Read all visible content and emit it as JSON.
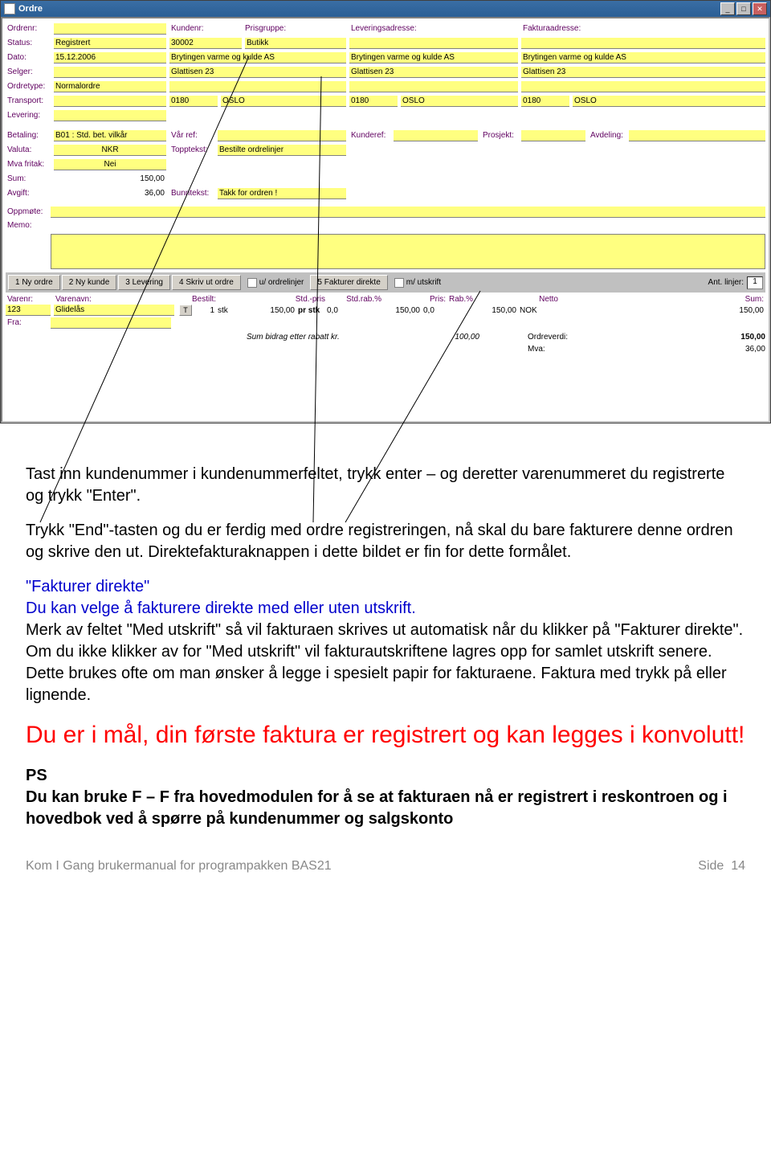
{
  "window": {
    "title": "Ordre"
  },
  "header": {
    "col1": {
      "ordrenr_lbl": "Ordrenr:",
      "status_lbl": "Status:",
      "status": "Registrert",
      "dato_lbl": "Dato:",
      "dato": "15.12.2006",
      "selger_lbl": "Selger:",
      "ordretype_lbl": "Ordretype:",
      "ordretype": "Normalordre",
      "transport_lbl": "Transport:",
      "levering_lbl": "Levering:"
    },
    "col2": {
      "kundenr_lbl": "Kundenr:",
      "kundenr": "30002",
      "prisgruppe_lbl": "Prisgruppe:",
      "prisgruppe": "Butikk",
      "navn": "Brytingen varme og kulde AS",
      "adresse": "Glattisen 23",
      "postnr": "0180",
      "sted": "OSLO"
    },
    "col3": {
      "lev_lbl": "Leveringsadresse:",
      "navn": "Brytingen varme og kulde AS",
      "adresse": "Glattisen 23",
      "postnr": "0180",
      "sted": "OSLO"
    },
    "col4": {
      "fak_lbl": "Fakturaadresse:",
      "navn": "Brytingen varme og kulde AS",
      "adresse": "Glattisen 23",
      "postnr": "0180",
      "sted": "OSLO"
    }
  },
  "mid": {
    "betaling_lbl": "Betaling:",
    "betaling": "B01 : Std. bet. vilkår",
    "valuta_lbl": "Valuta:",
    "valuta": "NKR",
    "mva_lbl": "Mva fritak:",
    "mva": "Nei",
    "sum_lbl": "Sum:",
    "sum": "150,00",
    "avgift_lbl": "Avgift:",
    "avgift": "36,00",
    "varref_lbl": "Vår ref:",
    "topptekst_lbl": "Topptekst:",
    "topptekst": "Bestilte ordrelinjer",
    "bunntekst_lbl": "Bunntekst:",
    "bunntekst": "Takk for ordren !",
    "kunderef_lbl": "Kunderef:",
    "prosjekt_lbl": "Prosjekt:",
    "avdeling_lbl": "Avdeling:"
  },
  "oppmote": {
    "lbl": "Oppmøte:",
    "memo_lbl": "Memo:"
  },
  "toolbar": {
    "b1": "1 Ny ordre",
    "b2": "2 Ny kunde",
    "b3": "3 Levering",
    "b4": "4 Skriv ut ordre",
    "chk1": "u/ ordrelinjer",
    "b5": "5 Fakturer direkte",
    "chk2": "m/ utskrift",
    "ant_lbl": "Ant. linjer:",
    "ant": "1"
  },
  "lines": {
    "hdr": {
      "varenr": "Varenr:",
      "varenavn": "Varenavn:",
      "bestilt": "Bestilt:",
      "stdpris": "Std.-pris",
      "stdrab": "Std.rab.%",
      "pris": "Pris:",
      "rab": "Rab.%",
      "netto": "Netto",
      "sum": "Sum:"
    },
    "row": {
      "varenr": "123",
      "varenavn": "Glidelås",
      "t": "T",
      "bestilt": "1",
      "enhet": "stk",
      "stdpris": "150,00",
      "prstk": "pr stk",
      "stdrab": "0,0",
      "pris": "150,00",
      "rab": "0,0",
      "netto": "150,00",
      "cur": "NOK",
      "sum": "150,00"
    },
    "fra_lbl": "Fra:",
    "sumbidrag_lbl": "Sum bidrag etter rabatt kr.",
    "sumbidrag": "100,00",
    "ordreverdi_lbl": "Ordreverdi:",
    "ordreverdi": "150,00",
    "mva_lbl": "Mva:",
    "mva": "36,00"
  },
  "doc": {
    "p1": "Tast inn kundenummer i kundenummerfeltet, trykk enter – og deretter varenummeret du registrerte og trykk \"Enter\".",
    "p2": "Trykk \"End\"-tasten og du er ferdig med ordre registreringen, nå skal du bare fakturere denne ordren og skrive den ut. Direktefakturaknappen i dette bildet er fin for dette formålet.",
    "p3a": "\"Fakturer direkte\"",
    "p3b": "Du kan velge å fakturere direkte med eller uten utskrift.",
    "p3c": "Merk av feltet \"Med utskrift\" så vil fakturaen skrives ut automatisk når du klikker på \"Fakturer direkte\". Om du ikke klikker av for \"Med utskrift\" vil fakturautskriftene lagres opp for samlet utskrift senere. Dette brukes ofte om man ønsker å legge i spesielt papir for fakturaene. Faktura med trykk på eller lignende.",
    "p4": "Du er i mål, din første faktura er registrert og kan legges i konvolutt!",
    "p5a": "PS",
    "p5b": "Du kan bruke F – F fra hovedmodulen for å se at fakturaen nå er registrert i reskontroen og i hovedbok ved å spørre på kundenummer og salgskonto"
  },
  "footer": {
    "left": "Kom I Gang brukermanual for programpakken BAS21",
    "right_lbl": "Side",
    "right_num": "14"
  }
}
